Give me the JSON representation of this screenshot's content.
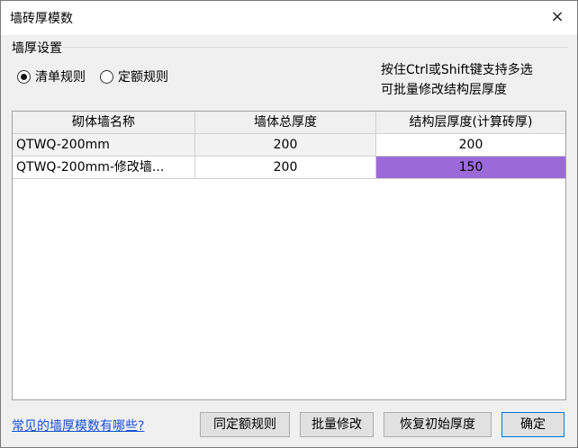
{
  "window": {
    "title": "墙砖厚模数",
    "close_icon": "×"
  },
  "group": {
    "title": "墙厚设置"
  },
  "radios": [
    {
      "label": "清单规则",
      "checked": true
    },
    {
      "label": "定额规则",
      "checked": false
    }
  ],
  "hint": {
    "line1": "按住Ctrl或Shift键支持多选",
    "line2": "可批量修改结构层厚度"
  },
  "table": {
    "headers": [
      "砌体墙名称",
      "墙体总厚度",
      "结构层厚度(计算砖厚)"
    ],
    "rows": [
      [
        "QTWQ-200mm",
        "200",
        "200"
      ],
      [
        "QTWQ-200mm-修改墙...",
        "200",
        "150"
      ]
    ]
  },
  "footer": {
    "link": "常见的墙厚模数有哪些?",
    "buttons": [
      "同定额规则",
      "批量修改",
      "恢复初始厚度",
      "确定"
    ]
  },
  "colors": {
    "selected_cell": "#9b6ad8",
    "link": "#1a4fd6"
  }
}
